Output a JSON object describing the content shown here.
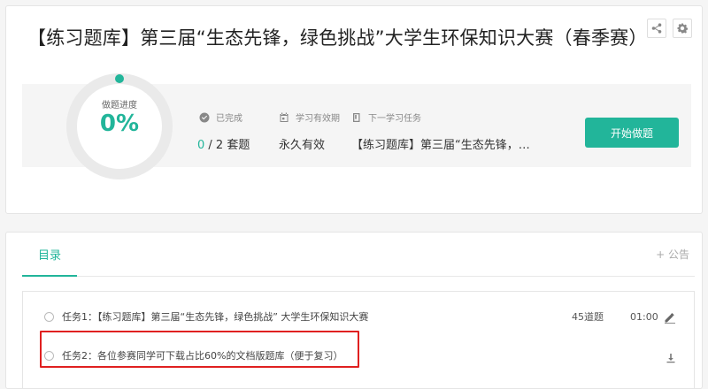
{
  "header": {
    "title": "【练习题库】第三届“生态先锋，绿色挑战”大学生环保知识大赛（春季赛）"
  },
  "progress": {
    "label": "做题进度",
    "percent_text": "0%",
    "fraction": 0
  },
  "stats": {
    "done_label": "已完成",
    "done_count": "0",
    "done_total": " / 2 套题",
    "validity_label": "学习有效期",
    "validity_value": "永久有效",
    "next_label": "下一学习任务",
    "next_value": "【练习题库】第三届“生态先锋，绿色挑战”大学生环保知识大赛"
  },
  "start_button": "开始做题",
  "tabs": {
    "catalog": "目录",
    "announcement": "+ 公告"
  },
  "tasks": [
    {
      "text": "任务1：【练习题库】第三届“生态先锋，绿色挑战” 大学生环保知识大赛",
      "count": "45道题",
      "time": "01:00"
    },
    {
      "text": "任务2：各位参赛同学可下载占比60%的文档版题库（便于复习）"
    }
  ],
  "colors": {
    "accent": "#22b59a",
    "highlight": "#e02020"
  },
  "icons": {
    "share": "share-icon",
    "settings": "gear-icon",
    "done": "check-circle-icon",
    "validity": "calendar-icon",
    "next": "book-icon",
    "edit": "pencil-icon",
    "download": "download-icon"
  }
}
